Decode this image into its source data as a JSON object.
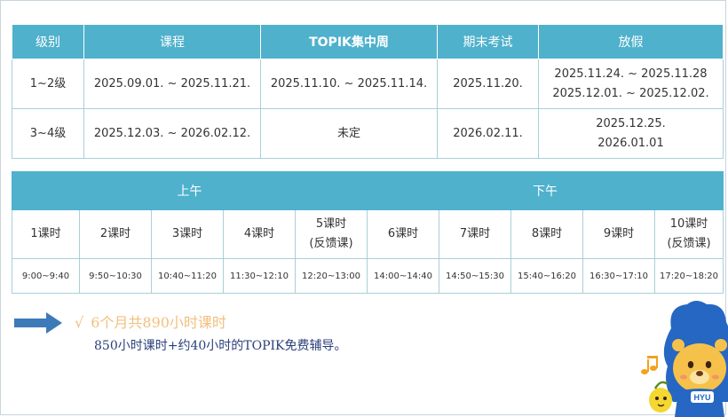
{
  "schedule": {
    "headers": [
      "级别",
      "课程",
      "TOPIK集中周",
      "期末考试",
      "放假"
    ],
    "rows": [
      {
        "level": "1~2级",
        "course": "2025.09.01. ~ 2025.11.21.",
        "topik": "2025.11.10. ~ 2025.11.14.",
        "exam": "2025.11.20.",
        "holiday_1": "2025.11.24. ~ 2025.11.28",
        "holiday_2": "2025.12.01. ~ 2025.12.02."
      },
      {
        "level": "3~4级",
        "course": "2025.12.03. ~ 2026.02.12.",
        "topik": "未定",
        "exam": "2026.02.11.",
        "holiday_1": "2025.12.25.",
        "holiday_2": "2026.01.01"
      }
    ]
  },
  "timetable": {
    "morning": "上午",
    "afternoon": "下午",
    "periods": [
      {
        "label": "1课时",
        "note": "",
        "time": "9:00~9:40"
      },
      {
        "label": "2课时",
        "note": "",
        "time": "9:50~10:30"
      },
      {
        "label": "3课时",
        "note": "",
        "time": "10:40~11:20"
      },
      {
        "label": "4课时",
        "note": "",
        "time": "11:30~12:10"
      },
      {
        "label": "5课时",
        "note": "(反馈课)",
        "time": "12:20~13:00"
      },
      {
        "label": "6课时",
        "note": "",
        "time": "14:00~14:40"
      },
      {
        "label": "7课时",
        "note": "",
        "time": "14:50~15:30"
      },
      {
        "label": "8课时",
        "note": "",
        "time": "15:40~16:20"
      },
      {
        "label": "9课时",
        "note": "",
        "time": "16:30~17:10"
      },
      {
        "label": "10课时",
        "note": "(反馈课)",
        "time": "17:20~18:20"
      }
    ]
  },
  "summary": {
    "check": "√",
    "headline": "6个月共890小时课时",
    "detail": "850小时课时+约40小时的TOPIK免费辅导。"
  },
  "mascot": {
    "badge": "HYU"
  },
  "colors": {
    "header_bg": "#4fb1cc",
    "border": "#a9cfdc",
    "arrow": "#3d7ab8",
    "headline": "#f2bf7e",
    "detail": "#2a3f7a"
  },
  "icons": [
    "right-arrow-icon",
    "music-note-icon",
    "lion-mascot-icon"
  ]
}
